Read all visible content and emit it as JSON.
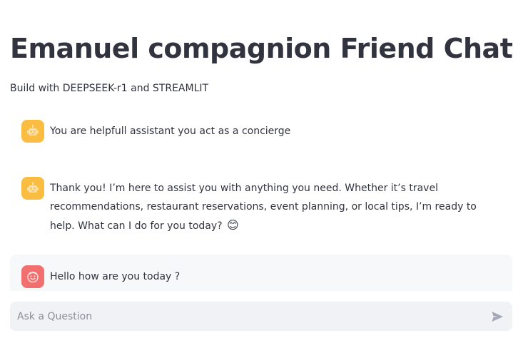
{
  "header": {
    "title": "Emanuel compagnion Friend Chat",
    "subtitle": "Build with DEEPSEEK-r1 and STREAMLIT"
  },
  "messages": [
    {
      "role": "assistant",
      "avatar_icon": "robot-icon",
      "text": "You are helpfull assistant you act as a concierge"
    },
    {
      "role": "assistant",
      "avatar_icon": "robot-icon",
      "text": "Thank you! I’m here to assist you with anything you need. Whether it’s travel recommendations, restaurant reservations, event planning, or local tips, I’m ready to help. What can I do for you today?",
      "emoji": "😊"
    },
    {
      "role": "user",
      "avatar_icon": "smiling-face-icon",
      "text": "Hello how are you today ?"
    }
  ],
  "chat_input": {
    "placeholder": "Ask a Question",
    "value": "",
    "send_icon": "send-icon"
  },
  "colors": {
    "assistant_avatar": "#fbbd41",
    "user_avatar": "#f26f6f",
    "user_message_bg": "#f7f8fa",
    "input_bg": "#f0f2f6",
    "text": "#31333f"
  }
}
